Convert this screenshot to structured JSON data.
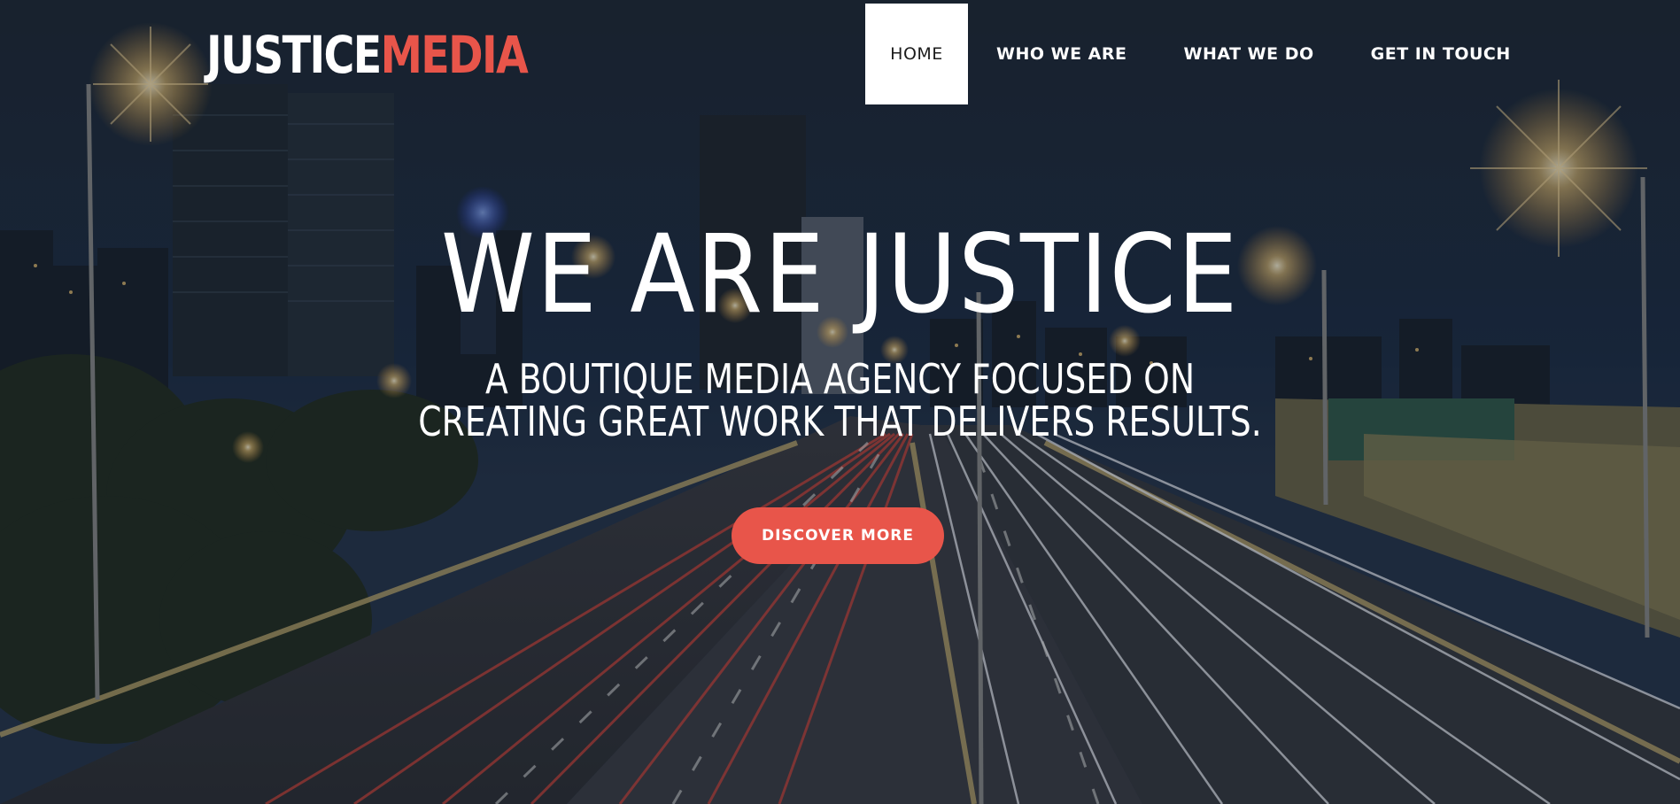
{
  "brand": {
    "word1": "JUSTICE",
    "word2": "MEDIA",
    "colors": {
      "primary_text": "#ffffff",
      "accent": "#e8554a"
    }
  },
  "nav": {
    "items": [
      {
        "label": "HOME",
        "active": true
      },
      {
        "label": "WHO WE ARE",
        "active": false
      },
      {
        "label": "WHAT WE DO",
        "active": false
      },
      {
        "label": "GET IN TOUCH",
        "active": false
      }
    ]
  },
  "hero": {
    "title": "WE ARE JUSTICE",
    "subtitle_line1": "A BOUTIQUE MEDIA AGENCY FOCUSED ON",
    "subtitle_line2": "CREATING GREAT WORK THAT DELIVERS RESULTS.",
    "cta_label": "DISCOVER MORE",
    "background": "night-city-highway-light-trails"
  }
}
